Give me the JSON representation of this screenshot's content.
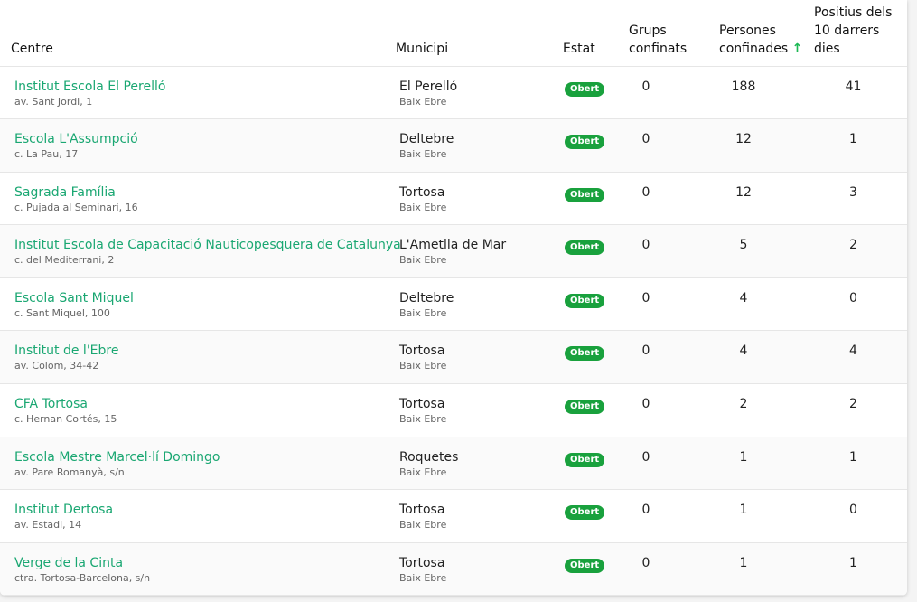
{
  "table": {
    "headers": {
      "centre": "Centre",
      "municipi": "Municipi",
      "estat": "Estat",
      "grups_confinats": "Grups confinats",
      "persones_confinades": "Persones confinades",
      "sort_indicator": "↑",
      "positius": "Positius dels 10 darrers dies"
    },
    "rows": [
      {
        "name": "Institut Escola El Perelló",
        "address": "av. Sant Jordi, 1",
        "municipi": "El Perelló",
        "comarca": "Baix Ebre",
        "estat": "Obert",
        "grups": "0",
        "persones": "188",
        "positius": "41"
      },
      {
        "name": "Escola L'Assumpció",
        "address": "c. La Pau, 17",
        "municipi": "Deltebre",
        "comarca": "Baix Ebre",
        "estat": "Obert",
        "grups": "0",
        "persones": "12",
        "positius": "1"
      },
      {
        "name": "Sagrada Família",
        "address": "c. Pujada al Seminari, 16",
        "municipi": "Tortosa",
        "comarca": "Baix Ebre",
        "estat": "Obert",
        "grups": "0",
        "persones": "12",
        "positius": "3"
      },
      {
        "name": "Institut Escola de Capacitació Nauticopesquera de Catalunya",
        "address": "c. del Mediterrani, 2",
        "municipi": "L'Ametlla de Mar",
        "comarca": "Baix Ebre",
        "estat": "Obert",
        "grups": "0",
        "persones": "5",
        "positius": "2"
      },
      {
        "name": "Escola Sant Miquel",
        "address": "c. Sant Miquel, 100",
        "municipi": "Deltebre",
        "comarca": "Baix Ebre",
        "estat": "Obert",
        "grups": "0",
        "persones": "4",
        "positius": "0"
      },
      {
        "name": "Institut de l'Ebre",
        "address": "av. Colom, 34-42",
        "municipi": "Tortosa",
        "comarca": "Baix Ebre",
        "estat": "Obert",
        "grups": "0",
        "persones": "4",
        "positius": "4"
      },
      {
        "name": "CFA Tortosa",
        "address": "c. Hernan Cortés, 15",
        "municipi": "Tortosa",
        "comarca": "Baix Ebre",
        "estat": "Obert",
        "grups": "0",
        "persones": "2",
        "positius": "2"
      },
      {
        "name": "Escola Mestre Marcel·lí Domingo",
        "address": "av. Pare Romanyà, s/n",
        "municipi": "Roquetes",
        "comarca": "Baix Ebre",
        "estat": "Obert",
        "grups": "0",
        "persones": "1",
        "positius": "1"
      },
      {
        "name": "Institut Dertosa",
        "address": "av. Estadi, 14",
        "municipi": "Tortosa",
        "comarca": "Baix Ebre",
        "estat": "Obert",
        "grups": "0",
        "persones": "1",
        "positius": "0"
      },
      {
        "name": "Verge de la Cinta",
        "address": "ctra. Tortosa-Barcelona, s/n",
        "municipi": "Tortosa",
        "comarca": "Baix Ebre",
        "estat": "Obert",
        "grups": "0",
        "persones": "1",
        "positius": "1"
      }
    ]
  },
  "colors": {
    "link": "#1aa772",
    "badge": "#19a13d",
    "sort_arrow": "#1db954"
  }
}
